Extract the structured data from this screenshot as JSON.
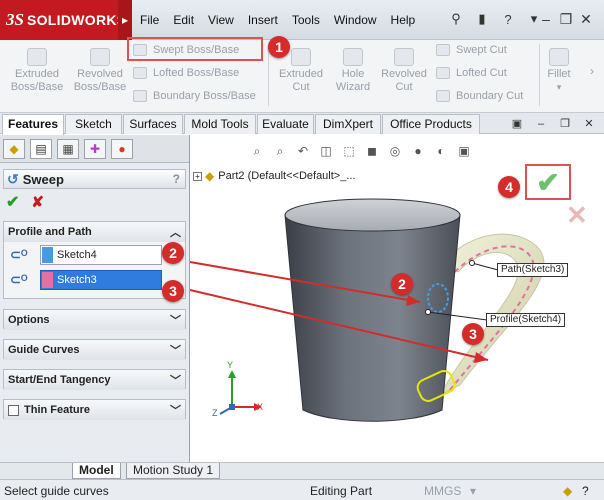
{
  "app": {
    "logo_ds": "3S",
    "logo_name": "SOLIDWORKS"
  },
  "menus": [
    "File",
    "Edit",
    "View",
    "Insert",
    "Tools",
    "Window",
    "Help"
  ],
  "command_manager": {
    "extruded_boss": "Extruded Boss/Base",
    "revolved_boss": "Revolved Boss/Base",
    "swept_boss": "Swept Boss/Base",
    "lofted_boss": "Lofted Boss/Base",
    "boundary_boss": "Boundary Boss/Base",
    "extruded_cut": "Extruded Cut",
    "hole_wizard": "Hole Wizard",
    "revolved_cut": "Revolved Cut",
    "swept_cut": "Swept Cut",
    "lofted_cut": "Lofted Cut",
    "boundary_cut": "Boundary Cut",
    "fillet": "Fillet"
  },
  "tabs": [
    "Features",
    "Sketch",
    "Surfaces",
    "Mold Tools",
    "Evaluate",
    "DimXpert",
    "Office Products"
  ],
  "property_manager": {
    "title": "Sweep",
    "help": "?",
    "profile_and_path": "Profile and Path",
    "profile_value": "Sketch4",
    "path_value": "Sketch3",
    "options": "Options",
    "guide_curves": "Guide Curves",
    "start_end_tangency": "Start/End Tangency",
    "thin_feature": "Thin Feature"
  },
  "graphics": {
    "tree_label": "Part2  (Default<<Default>_...",
    "path_callout": "Path(Sketch3)",
    "profile_callout": "Profile(Sketch4)",
    "axis_x": "X",
    "axis_y": "Y",
    "axis_z": "Z"
  },
  "badges": {
    "b1": "1",
    "b2": "2",
    "b3": "3",
    "b4": "4"
  },
  "bottom_tabs": [
    "Model",
    "Motion Study 1"
  ],
  "status": {
    "left": "Select guide curves",
    "mode": "Editing Part",
    "units": "MMGS"
  },
  "colors": {
    "accent_red": "#d42b2b",
    "selection_blue": "#2f7bde",
    "profile_swatch": "#e46fa5",
    "path_swatch": "#4a9ae0"
  }
}
